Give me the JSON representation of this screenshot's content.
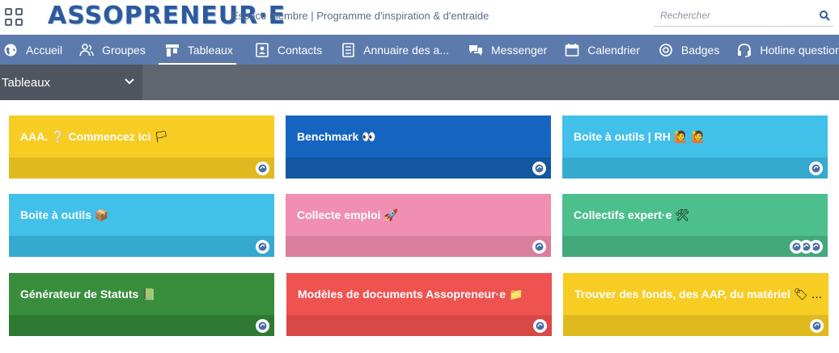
{
  "header": {
    "logo_text": "ASSOPRENEUR·E",
    "subtitle": "Espace membre | Programme d'inspiration & d'entraide",
    "search_placeholder": "Rechercher"
  },
  "nav": {
    "items": [
      {
        "label": "Accueil",
        "icon": "globe-icon"
      },
      {
        "label": "Groupes",
        "icon": "groups-icon"
      },
      {
        "label": "Tableaux",
        "icon": "boards-icon",
        "active": true
      },
      {
        "label": "Contacts",
        "icon": "contacts-icon"
      },
      {
        "label": "Annuaire des a...",
        "icon": "directory-icon"
      },
      {
        "label": "Messenger",
        "icon": "chat-icon"
      },
      {
        "label": "Calendrier",
        "icon": "calendar-icon"
      },
      {
        "label": "Badges",
        "icon": "badge-icon"
      },
      {
        "label": "Hotline question",
        "icon": "headset-icon"
      }
    ]
  },
  "subbar": {
    "dropdown_label": "Tableaux"
  },
  "cards": [
    {
      "title": "AAA. ❔ Commencez ici",
      "emoji": "🏳",
      "color": "#f7cc23",
      "band": "#e0b91f"
    },
    {
      "title": "Benchmark",
      "emoji": "👀",
      "color": "#1565c0",
      "band": "#12579f"
    },
    {
      "title": "Boite à outils | RH",
      "emoji": "🙋 🙋",
      "color": "#41c0ea",
      "band": "#36a9cf"
    },
    {
      "title": "Boite à outils",
      "emoji": "📦",
      "color": "#41c0ea",
      "band": "#36a9cf"
    },
    {
      "title": "Collecte emploi",
      "emoji": "🚀",
      "color": "#f08fb1",
      "band": "#d97f9d"
    },
    {
      "title": "Collectifs expert·e",
      "emoji": "🛠",
      "color": "#4dbf8d",
      "band": "#43a87b"
    },
    {
      "title": "Générateur de Statuts",
      "emoji": "📗",
      "color": "#388e3c",
      "band": "#2f7a33"
    },
    {
      "title": "Modèles de documents Assopreneur·e",
      "emoji": "📁",
      "color": "#ef5350",
      "band": "#d84846"
    },
    {
      "title": "Trouver des fonds, des AAP, du matériel",
      "emoji": "🏷 …",
      "color": "#f7cc23",
      "band": "#e0b91f"
    }
  ]
}
